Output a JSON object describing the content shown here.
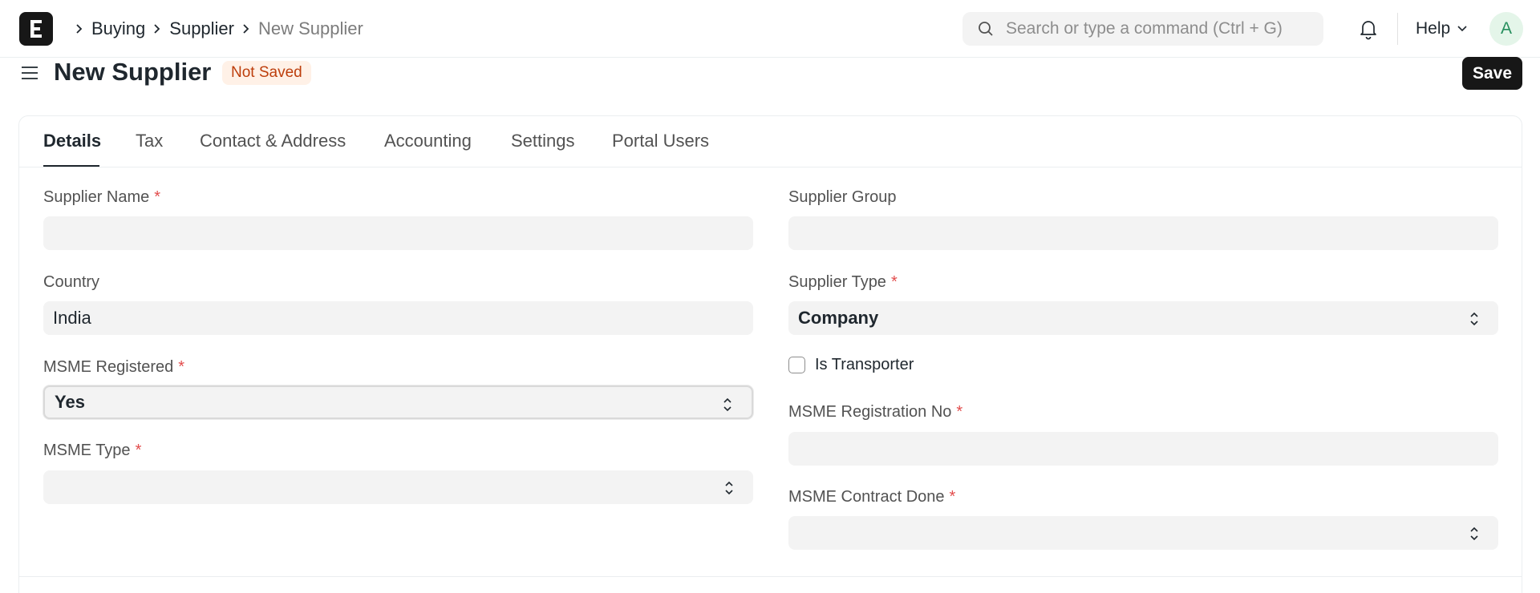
{
  "breadcrumb": [
    "Buying",
    "Supplier",
    "New Supplier"
  ],
  "search": {
    "placeholder": "Search or type a command (Ctrl + G)"
  },
  "help_label": "Help",
  "avatar_initial": "A",
  "page": {
    "title": "New Supplier",
    "status": "Not Saved",
    "save_label": "Save"
  },
  "tabs": [
    "Details",
    "Tax",
    "Contact & Address",
    "Accounting",
    "Settings",
    "Portal Users"
  ],
  "active_tab": "Details",
  "fields": {
    "supplier_name": {
      "label": "Supplier Name",
      "required": "*",
      "value": ""
    },
    "supplier_group": {
      "label": "Supplier Group",
      "value": ""
    },
    "country": {
      "label": "Country",
      "value": "India"
    },
    "supplier_type": {
      "label": "Supplier Type",
      "required": "*",
      "value": "Company"
    },
    "msme_registered": {
      "label": "MSME Registered",
      "required": "*",
      "value": "Yes"
    },
    "is_transporter": {
      "label": "Is Transporter",
      "checked": false
    },
    "msme_type": {
      "label": "MSME Type",
      "required": "*",
      "value": ""
    },
    "msme_registration_no": {
      "label": "MSME Registration No",
      "required": "*",
      "value": ""
    },
    "msme_contract_done": {
      "label": "MSME Contract Done",
      "required": "*",
      "value": ""
    }
  },
  "colors": {
    "required": "#e24c4c",
    "badge_bg": "#fff1e7",
    "badge_text": "#bd3e0c",
    "primary_button": "#171717"
  }
}
